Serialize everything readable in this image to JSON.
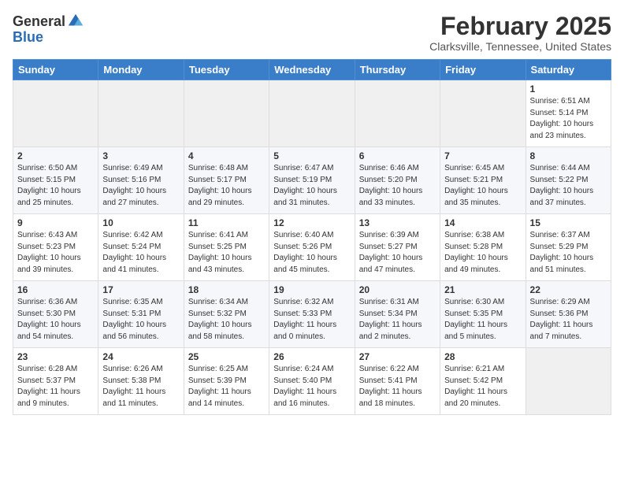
{
  "logo": {
    "general": "General",
    "blue": "Blue"
  },
  "title": {
    "month_year": "February 2025",
    "location": "Clarksville, Tennessee, United States"
  },
  "headers": [
    "Sunday",
    "Monday",
    "Tuesday",
    "Wednesday",
    "Thursday",
    "Friday",
    "Saturday"
  ],
  "weeks": [
    [
      {
        "day": "",
        "info": ""
      },
      {
        "day": "",
        "info": ""
      },
      {
        "day": "",
        "info": ""
      },
      {
        "day": "",
        "info": ""
      },
      {
        "day": "",
        "info": ""
      },
      {
        "day": "",
        "info": ""
      },
      {
        "day": "1",
        "info": "Sunrise: 6:51 AM\nSunset: 5:14 PM\nDaylight: 10 hours and 23 minutes."
      }
    ],
    [
      {
        "day": "2",
        "info": "Sunrise: 6:50 AM\nSunset: 5:15 PM\nDaylight: 10 hours and 25 minutes."
      },
      {
        "day": "3",
        "info": "Sunrise: 6:49 AM\nSunset: 5:16 PM\nDaylight: 10 hours and 27 minutes."
      },
      {
        "day": "4",
        "info": "Sunrise: 6:48 AM\nSunset: 5:17 PM\nDaylight: 10 hours and 29 minutes."
      },
      {
        "day": "5",
        "info": "Sunrise: 6:47 AM\nSunset: 5:19 PM\nDaylight: 10 hours and 31 minutes."
      },
      {
        "day": "6",
        "info": "Sunrise: 6:46 AM\nSunset: 5:20 PM\nDaylight: 10 hours and 33 minutes."
      },
      {
        "day": "7",
        "info": "Sunrise: 6:45 AM\nSunset: 5:21 PM\nDaylight: 10 hours and 35 minutes."
      },
      {
        "day": "8",
        "info": "Sunrise: 6:44 AM\nSunset: 5:22 PM\nDaylight: 10 hours and 37 minutes."
      }
    ],
    [
      {
        "day": "9",
        "info": "Sunrise: 6:43 AM\nSunset: 5:23 PM\nDaylight: 10 hours and 39 minutes."
      },
      {
        "day": "10",
        "info": "Sunrise: 6:42 AM\nSunset: 5:24 PM\nDaylight: 10 hours and 41 minutes."
      },
      {
        "day": "11",
        "info": "Sunrise: 6:41 AM\nSunset: 5:25 PM\nDaylight: 10 hours and 43 minutes."
      },
      {
        "day": "12",
        "info": "Sunrise: 6:40 AM\nSunset: 5:26 PM\nDaylight: 10 hours and 45 minutes."
      },
      {
        "day": "13",
        "info": "Sunrise: 6:39 AM\nSunset: 5:27 PM\nDaylight: 10 hours and 47 minutes."
      },
      {
        "day": "14",
        "info": "Sunrise: 6:38 AM\nSunset: 5:28 PM\nDaylight: 10 hours and 49 minutes."
      },
      {
        "day": "15",
        "info": "Sunrise: 6:37 AM\nSunset: 5:29 PM\nDaylight: 10 hours and 51 minutes."
      }
    ],
    [
      {
        "day": "16",
        "info": "Sunrise: 6:36 AM\nSunset: 5:30 PM\nDaylight: 10 hours and 54 minutes."
      },
      {
        "day": "17",
        "info": "Sunrise: 6:35 AM\nSunset: 5:31 PM\nDaylight: 10 hours and 56 minutes."
      },
      {
        "day": "18",
        "info": "Sunrise: 6:34 AM\nSunset: 5:32 PM\nDaylight: 10 hours and 58 minutes."
      },
      {
        "day": "19",
        "info": "Sunrise: 6:32 AM\nSunset: 5:33 PM\nDaylight: 11 hours and 0 minutes."
      },
      {
        "day": "20",
        "info": "Sunrise: 6:31 AM\nSunset: 5:34 PM\nDaylight: 11 hours and 2 minutes."
      },
      {
        "day": "21",
        "info": "Sunrise: 6:30 AM\nSunset: 5:35 PM\nDaylight: 11 hours and 5 minutes."
      },
      {
        "day": "22",
        "info": "Sunrise: 6:29 AM\nSunset: 5:36 PM\nDaylight: 11 hours and 7 minutes."
      }
    ],
    [
      {
        "day": "23",
        "info": "Sunrise: 6:28 AM\nSunset: 5:37 PM\nDaylight: 11 hours and 9 minutes."
      },
      {
        "day": "24",
        "info": "Sunrise: 6:26 AM\nSunset: 5:38 PM\nDaylight: 11 hours and 11 minutes."
      },
      {
        "day": "25",
        "info": "Sunrise: 6:25 AM\nSunset: 5:39 PM\nDaylight: 11 hours and 14 minutes."
      },
      {
        "day": "26",
        "info": "Sunrise: 6:24 AM\nSunset: 5:40 PM\nDaylight: 11 hours and 16 minutes."
      },
      {
        "day": "27",
        "info": "Sunrise: 6:22 AM\nSunset: 5:41 PM\nDaylight: 11 hours and 18 minutes."
      },
      {
        "day": "28",
        "info": "Sunrise: 6:21 AM\nSunset: 5:42 PM\nDaylight: 11 hours and 20 minutes."
      },
      {
        "day": "",
        "info": ""
      }
    ]
  ]
}
